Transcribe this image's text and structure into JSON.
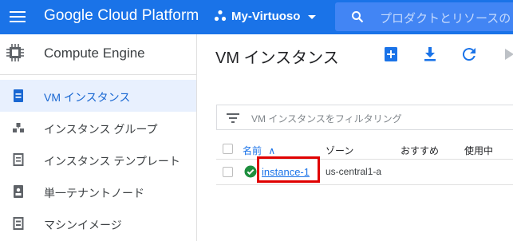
{
  "topbar": {
    "brand": "Google Cloud Platform",
    "project_name": "My-Virtuoso",
    "search_placeholder": "プロダクトとリソースの",
    "bg_color": "#1a73e8"
  },
  "sidebar": {
    "title": "Compute Engine",
    "items": [
      {
        "label": "VM インスタンス",
        "icon": "vm-instance-icon",
        "active": true
      },
      {
        "label": "インスタンス グループ",
        "icon": "instance-group-icon",
        "active": false
      },
      {
        "label": "インスタンス テンプレート",
        "icon": "instance-template-icon",
        "active": false
      },
      {
        "label": "単一テナントノード",
        "icon": "sole-tenant-icon",
        "active": false
      },
      {
        "label": "マシンイメージ",
        "icon": "machine-image-icon",
        "active": false
      }
    ]
  },
  "main": {
    "title": "VM インスタンス",
    "toolbar_icons": [
      "create-instance-icon",
      "import-vm-icon",
      "refresh-icon",
      "play-icon"
    ],
    "filter_placeholder": "VM インスタンスをフィルタリング",
    "columns": [
      "名前",
      "ゾーン",
      "おすすめ",
      "使用中"
    ],
    "sort_arrow": "∧",
    "rows": [
      {
        "name": "instance-1",
        "zone": "us-central1-a",
        "status": "running",
        "status_color": "#1e8e3e"
      }
    ]
  }
}
